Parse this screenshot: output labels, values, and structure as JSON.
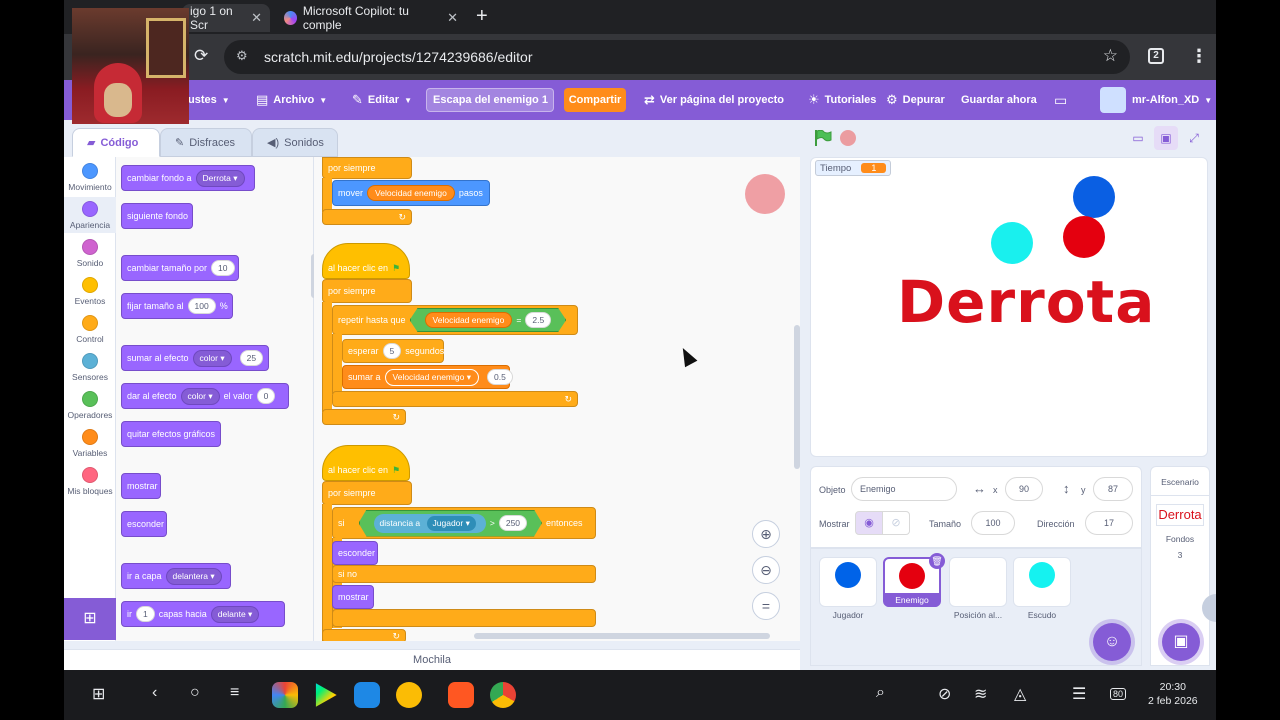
{
  "browser": {
    "tabs": [
      {
        "label": "igo 1 on Scr"
      },
      {
        "label": "Microsoft Copilot: tu comple"
      }
    ],
    "url": "scratch.mit.edu/projects/1274239686/editor",
    "tab_count": "2"
  },
  "menubar": {
    "settings": "ustes",
    "file": "Archivo",
    "edit": "Editar",
    "project_title": "Escapa del enemigo 1",
    "share": "Compartir",
    "see_project": "Ver página del proyecto",
    "tutorials": "Tutoriales",
    "debug": "Depurar",
    "save_now": "Guardar ahora",
    "username": "mr-Alfon_XD"
  },
  "editor_tabs": {
    "code": "Código",
    "costumes": "Disfraces",
    "sounds": "Sonidos"
  },
  "categories": [
    {
      "label": "Movimiento",
      "color": "#4c97ff"
    },
    {
      "label": "Apariencia",
      "color": "#9966ff"
    },
    {
      "label": "Sonido",
      "color": "#cf63cf"
    },
    {
      "label": "Eventos",
      "color": "#ffbf00"
    },
    {
      "label": "Control",
      "color": "#ffab19"
    },
    {
      "label": "Sensores",
      "color": "#5cb1d6"
    },
    {
      "label": "Operadores",
      "color": "#59c059"
    },
    {
      "label": "Variables",
      "color": "#ff8c1a"
    },
    {
      "label": "Mis bloques",
      "color": "#ff6680"
    }
  ],
  "palette": {
    "switch_backdrop": "cambiar fondo a",
    "switch_backdrop_value": "Derrota",
    "next_backdrop": "siguiente fondo",
    "change_size": "cambiar tamaño por",
    "change_size_value": "10",
    "set_size": "fijar tamaño al",
    "set_size_value": "100",
    "set_size_unit": "%",
    "change_effect": "sumar al efecto",
    "change_effect_menu": "color",
    "change_effect_value": "25",
    "set_effect": "dar al efecto",
    "set_effect_menu": "color",
    "set_effect_mid": "el valor",
    "set_effect_value": "0",
    "clear_effects": "quitar efectos gráficos",
    "show": "mostrar",
    "hide": "esconder",
    "go_to_layer": "ir a capa",
    "go_to_layer_menu": "delantera",
    "go_layers_pre": "ir",
    "go_layers_value": "1",
    "go_layers_mid": "capas hacia",
    "go_layers_menu": "delante"
  },
  "scripts": {
    "forever": "por siempre",
    "move": "mover",
    "move_var": "Velocidad enemigo",
    "move_suffix": "pasos",
    "when_flag": "al hacer clic en",
    "repeat_until": "repetir hasta que",
    "cond_var": "Velocidad enemigo",
    "cond_op": "=",
    "cond_value": "2.5",
    "wait": "esperar",
    "wait_value": "5",
    "wait_unit": "segundos",
    "change_var": "sumar a",
    "change_var_menu": "Velocidad enemigo",
    "change_var_value": "0.5",
    "if": "si",
    "distance_to": "distancia a",
    "distance_target": "Jugador",
    "gt": ">",
    "gt_value": "250",
    "then": "entonces",
    "hide": "esconder",
    "else": "si no",
    "show": "mostrar"
  },
  "backpack": "Mochila",
  "stage": {
    "monitor_label": "Tiempo",
    "monitor_value": "1",
    "text": "Derrota"
  },
  "sprite_info": {
    "sprite_label": "Objeto",
    "sprite_name": "Enemigo",
    "x_label": "x",
    "x_value": "90",
    "y_label": "y",
    "y_value": "87",
    "show_label": "Mostrar",
    "size_label": "Tamaño",
    "size_value": "100",
    "direction_label": "Dirección",
    "direction_value": "17"
  },
  "sprites": [
    {
      "name": "Jugador",
      "color": "#0063e8"
    },
    {
      "name": "Enemigo",
      "color": "#e4000f"
    },
    {
      "name": "Posición al...",
      "color": ""
    },
    {
      "name": "Escudo",
      "color": "#15f2f0"
    }
  ],
  "stage_pane": {
    "title": "Escenario",
    "thumb_text": "Derrota",
    "backdrops_label": "Fondos",
    "backdrops_count": "3"
  },
  "system": {
    "time": "20:30",
    "date": "2 feb 2026",
    "battery": "80"
  }
}
